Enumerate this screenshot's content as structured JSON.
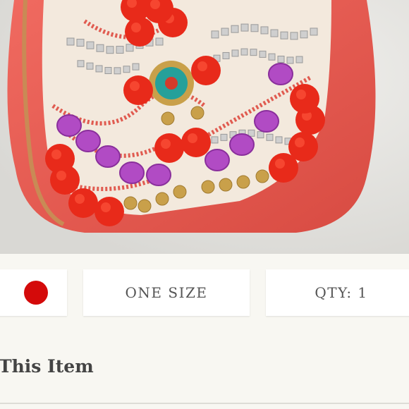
{
  "product": {
    "image_alt": "Embellished coral bag with beads and pom-poms",
    "colors": {
      "swatch": "#d40a0a",
      "bag_coral": "#e8564d",
      "pompom_red": "#e82a1a",
      "bead_purple": "#b14bc4",
      "bead_teal": "#25a09a",
      "gold": "#c9a04a",
      "backdrop": "#e7e6e2"
    }
  },
  "options": {
    "size_label": "ONE SIZE",
    "qty_label": "QTY: 1"
  },
  "section": {
    "title": "This Item"
  }
}
